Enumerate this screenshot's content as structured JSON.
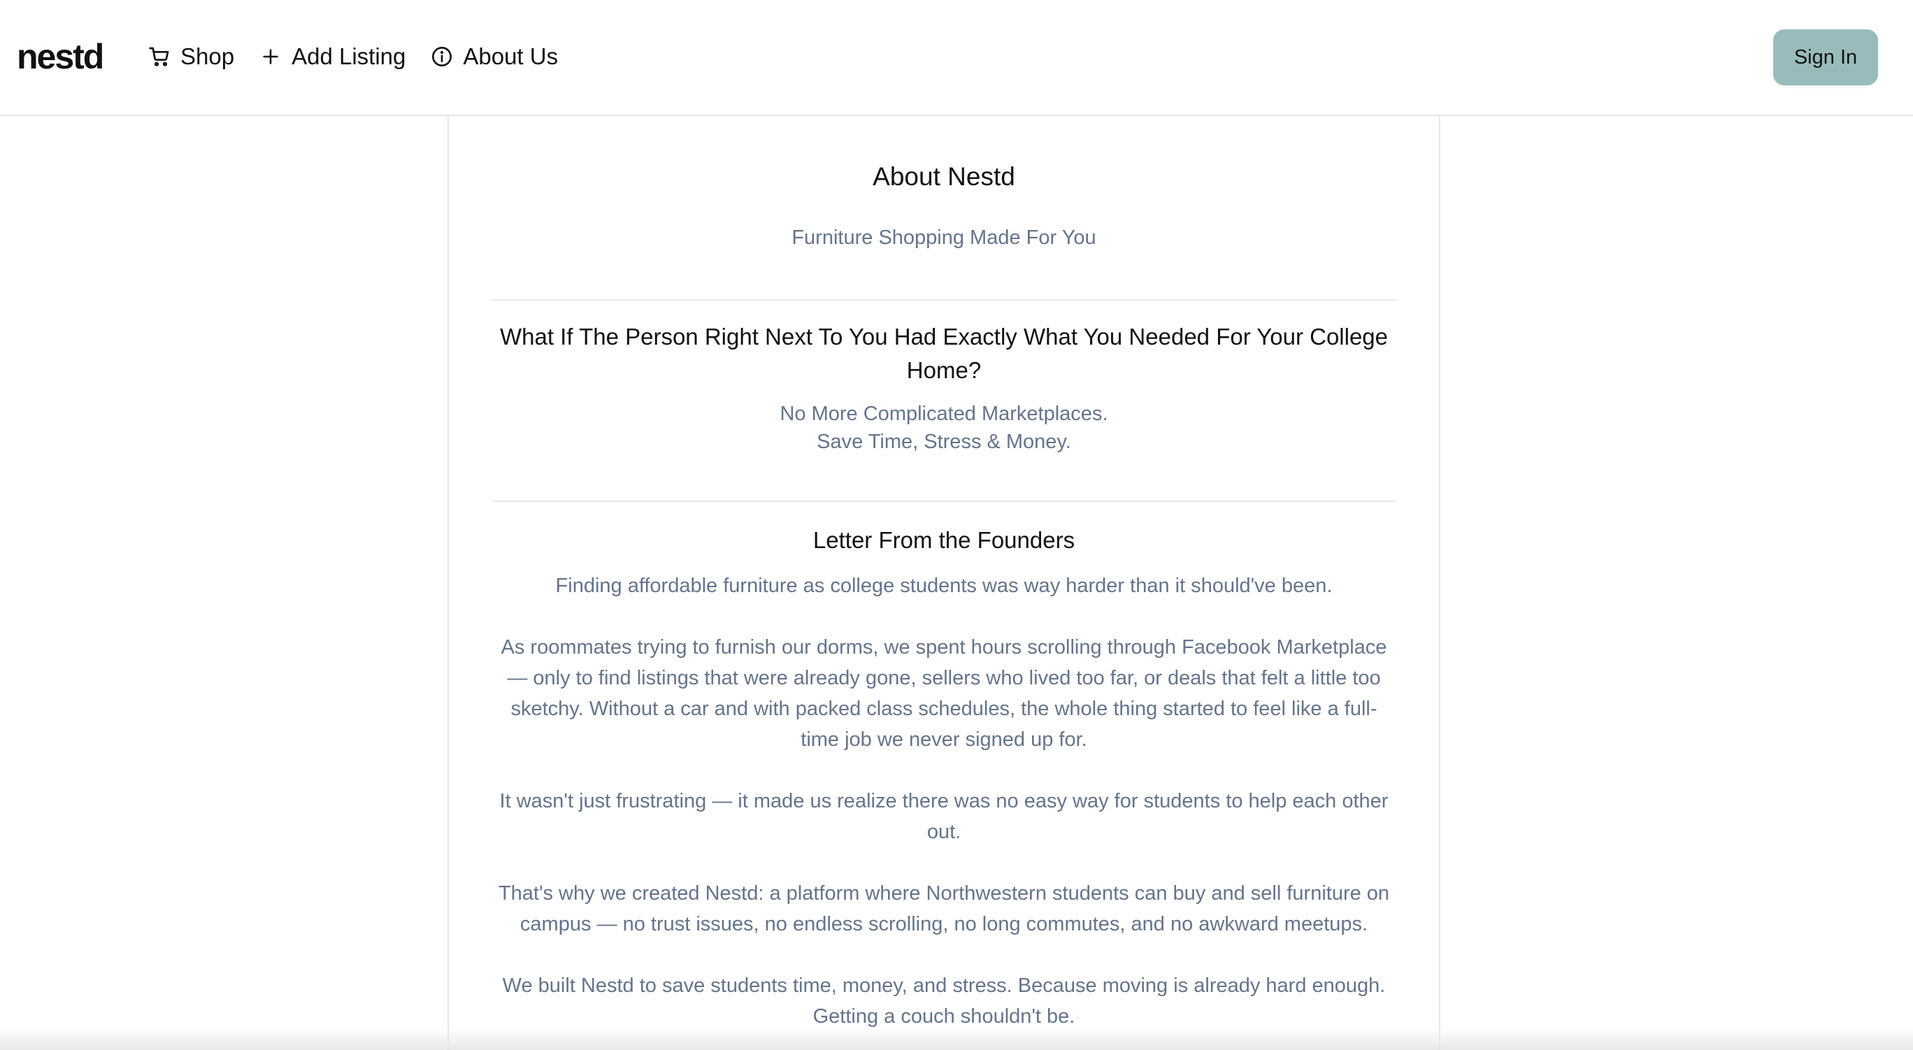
{
  "header": {
    "logo": "nestd",
    "nav": [
      {
        "label": "Shop",
        "icon": "cart-icon"
      },
      {
        "label": "Add Listing",
        "icon": "plus-icon"
      },
      {
        "label": "About Us",
        "icon": "info-icon"
      }
    ],
    "signin_label": "Sign In"
  },
  "about": {
    "title": "About Nestd",
    "subtitle": "Furniture Shopping Made For You",
    "question": "What If The Person Right Next To You Had Exactly What You Needed For Your College Home?",
    "tagline_1": "No More Complicated Marketplaces.",
    "tagline_2": "Save Time, Stress & Money."
  },
  "letter": {
    "title": "Letter From the Founders",
    "paragraphs": [
      "Finding affordable furniture as college students was way harder than it should've been.",
      "As roommates trying to furnish our dorms, we spent hours scrolling through Facebook Marketplace — only to find listings that were already gone, sellers who lived too far, or deals that felt a little too sketchy. Without a car and with packed class schedules, the whole thing started to feel like a full-time job we never signed up for.",
      "It wasn't just frustrating — it made us realize there was no easy way for students to help each other out.",
      "That's why we created Nestd: a platform where Northwestern students can buy and sell furniture on campus — no trust issues, no endless scrolling, no long commutes, and no awkward meetups.",
      "We built Nestd to save students time, money, and stress. Because moving is already hard enough. Getting a couch shouldn't be."
    ]
  },
  "colors": {
    "accent": "#97bcbb",
    "muted_text": "#64748b",
    "border": "#e5e7eb"
  }
}
